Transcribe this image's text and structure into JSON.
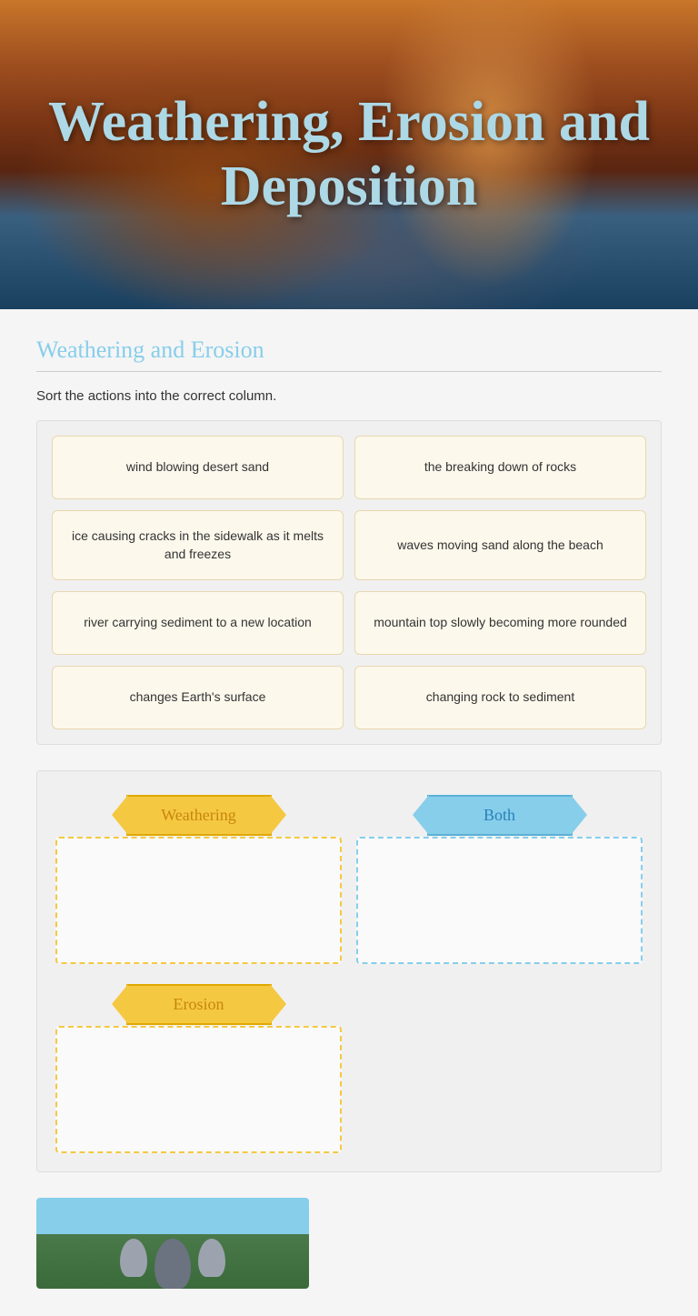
{
  "hero": {
    "title": "Weathering, Erosion and Deposition"
  },
  "section": {
    "heading": "Weathering and Erosion",
    "instruction": "Sort the actions into the correct column."
  },
  "cards": [
    {
      "id": "card-1",
      "text": "wind blowing desert sand"
    },
    {
      "id": "card-2",
      "text": "the breaking down of rocks"
    },
    {
      "id": "card-3",
      "text": "ice causing cracks in the sidewalk as it melts and freezes"
    },
    {
      "id": "card-4",
      "text": "waves moving sand along the beach"
    },
    {
      "id": "card-5",
      "text": "river carrying sediment to a new location"
    },
    {
      "id": "card-6",
      "text": "mountain top slowly becoming more rounded"
    },
    {
      "id": "card-7",
      "text": "changes Earth's surface"
    },
    {
      "id": "card-8",
      "text": "changing rock to sediment"
    }
  ],
  "dropzones": {
    "weathering_label": "Weathering",
    "both_label": "Both",
    "erosion_label": "Erosion"
  }
}
